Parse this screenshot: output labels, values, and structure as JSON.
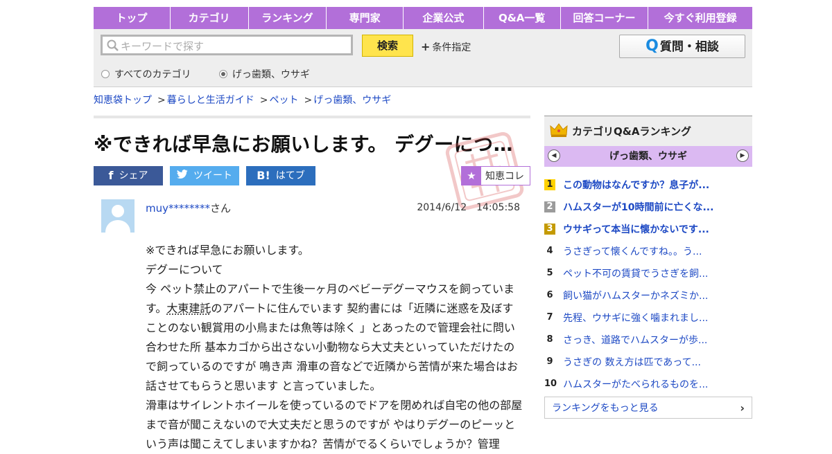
{
  "nav": [
    "トップ",
    "カテゴリ",
    "ランキング",
    "専門家",
    "企業公式",
    "Q&A一覧",
    "回答コーナー",
    "今すぐ利用登録"
  ],
  "search": {
    "placeholder": "キーワードで探す",
    "button": "検索",
    "condition": "条件指定",
    "ask_button": "質問・相談",
    "radio_all": "すべてのカテゴリ",
    "radio_cat": "げっ歯類、ウサギ",
    "selected": "げっ歯類、ウサギ"
  },
  "breadcrumb": [
    "知恵袋トップ",
    "暮らしと生活ガイド",
    "ペット",
    "げっ歯類、ウサギ"
  ],
  "question": {
    "title": "※できれば早急にお願いします。 デグーにつ...",
    "share": {
      "facebook": "シェア",
      "twitter": "ツイート",
      "hatena": "はてブ"
    },
    "chiecolle": "知恵コレ",
    "user": "muy********",
    "user_suffix": "さん",
    "date": "2014/6/12　14:05:58",
    "body": {
      "p1": "※できれば早急にお願いします。",
      "p2": "デグーについて",
      "p3a": "今 ペット禁止のアパートで生後一ヶ月のベビーデグーマウスを飼っています。",
      "p3link": "大東建託",
      "p3b": "のアパートに住んでいます 契約書には「近隣に迷惑を及ぼすことのない観賞用の小鳥または魚等は除く 」とあったので管理会社に問い合わせた所 基本カゴから出さない小動物なら大丈夫といっていただけたので飼っているのですが 鳴き声 滑車の音などで近隣から苦情が来た場合はお話させてもらうと思います と言っていました。",
      "p4": "滑車はサイレントホイールを使っているのでドアを閉めれば自宅の他の部屋まで音が聞こえないので大丈夫だと思うのですが やはりデグーのピーッという声は聞こえてしまいますかね？苦情がでるくらいでしょうか？管理"
    }
  },
  "sidebar": {
    "title": "カテゴリQ&Aランキング",
    "category": "げっ歯類、ウサギ",
    "ranking": [
      {
        "n": "1",
        "title": "この動物はなんですか？息子が..."
      },
      {
        "n": "2",
        "title": "ハムスターが10時間前に亡くな..."
      },
      {
        "n": "3",
        "title": "ウサギって本当に懐かないです..."
      },
      {
        "n": "4",
        "title": "うさぎって懐くんですね。。う..."
      },
      {
        "n": "5",
        "title": "ペット不可の賃貸でうさぎを飼..."
      },
      {
        "n": "6",
        "title": "飼い猫がハムスターかネズミか..."
      },
      {
        "n": "7",
        "title": "先程、ウサギに強く噛まれまし..."
      },
      {
        "n": "8",
        "title": "さっき、道路でハムスターが歩..."
      },
      {
        "n": "9",
        "title": "うさぎの 数え方は匹であって..."
      },
      {
        "n": "10",
        "title": "ハムスターがたべられるものを..."
      }
    ],
    "more": "ランキングをもっと見る"
  },
  "colors": {
    "accent": "#b26fd9",
    "link": "#1d49c4",
    "search_button": "#ffe44d"
  }
}
